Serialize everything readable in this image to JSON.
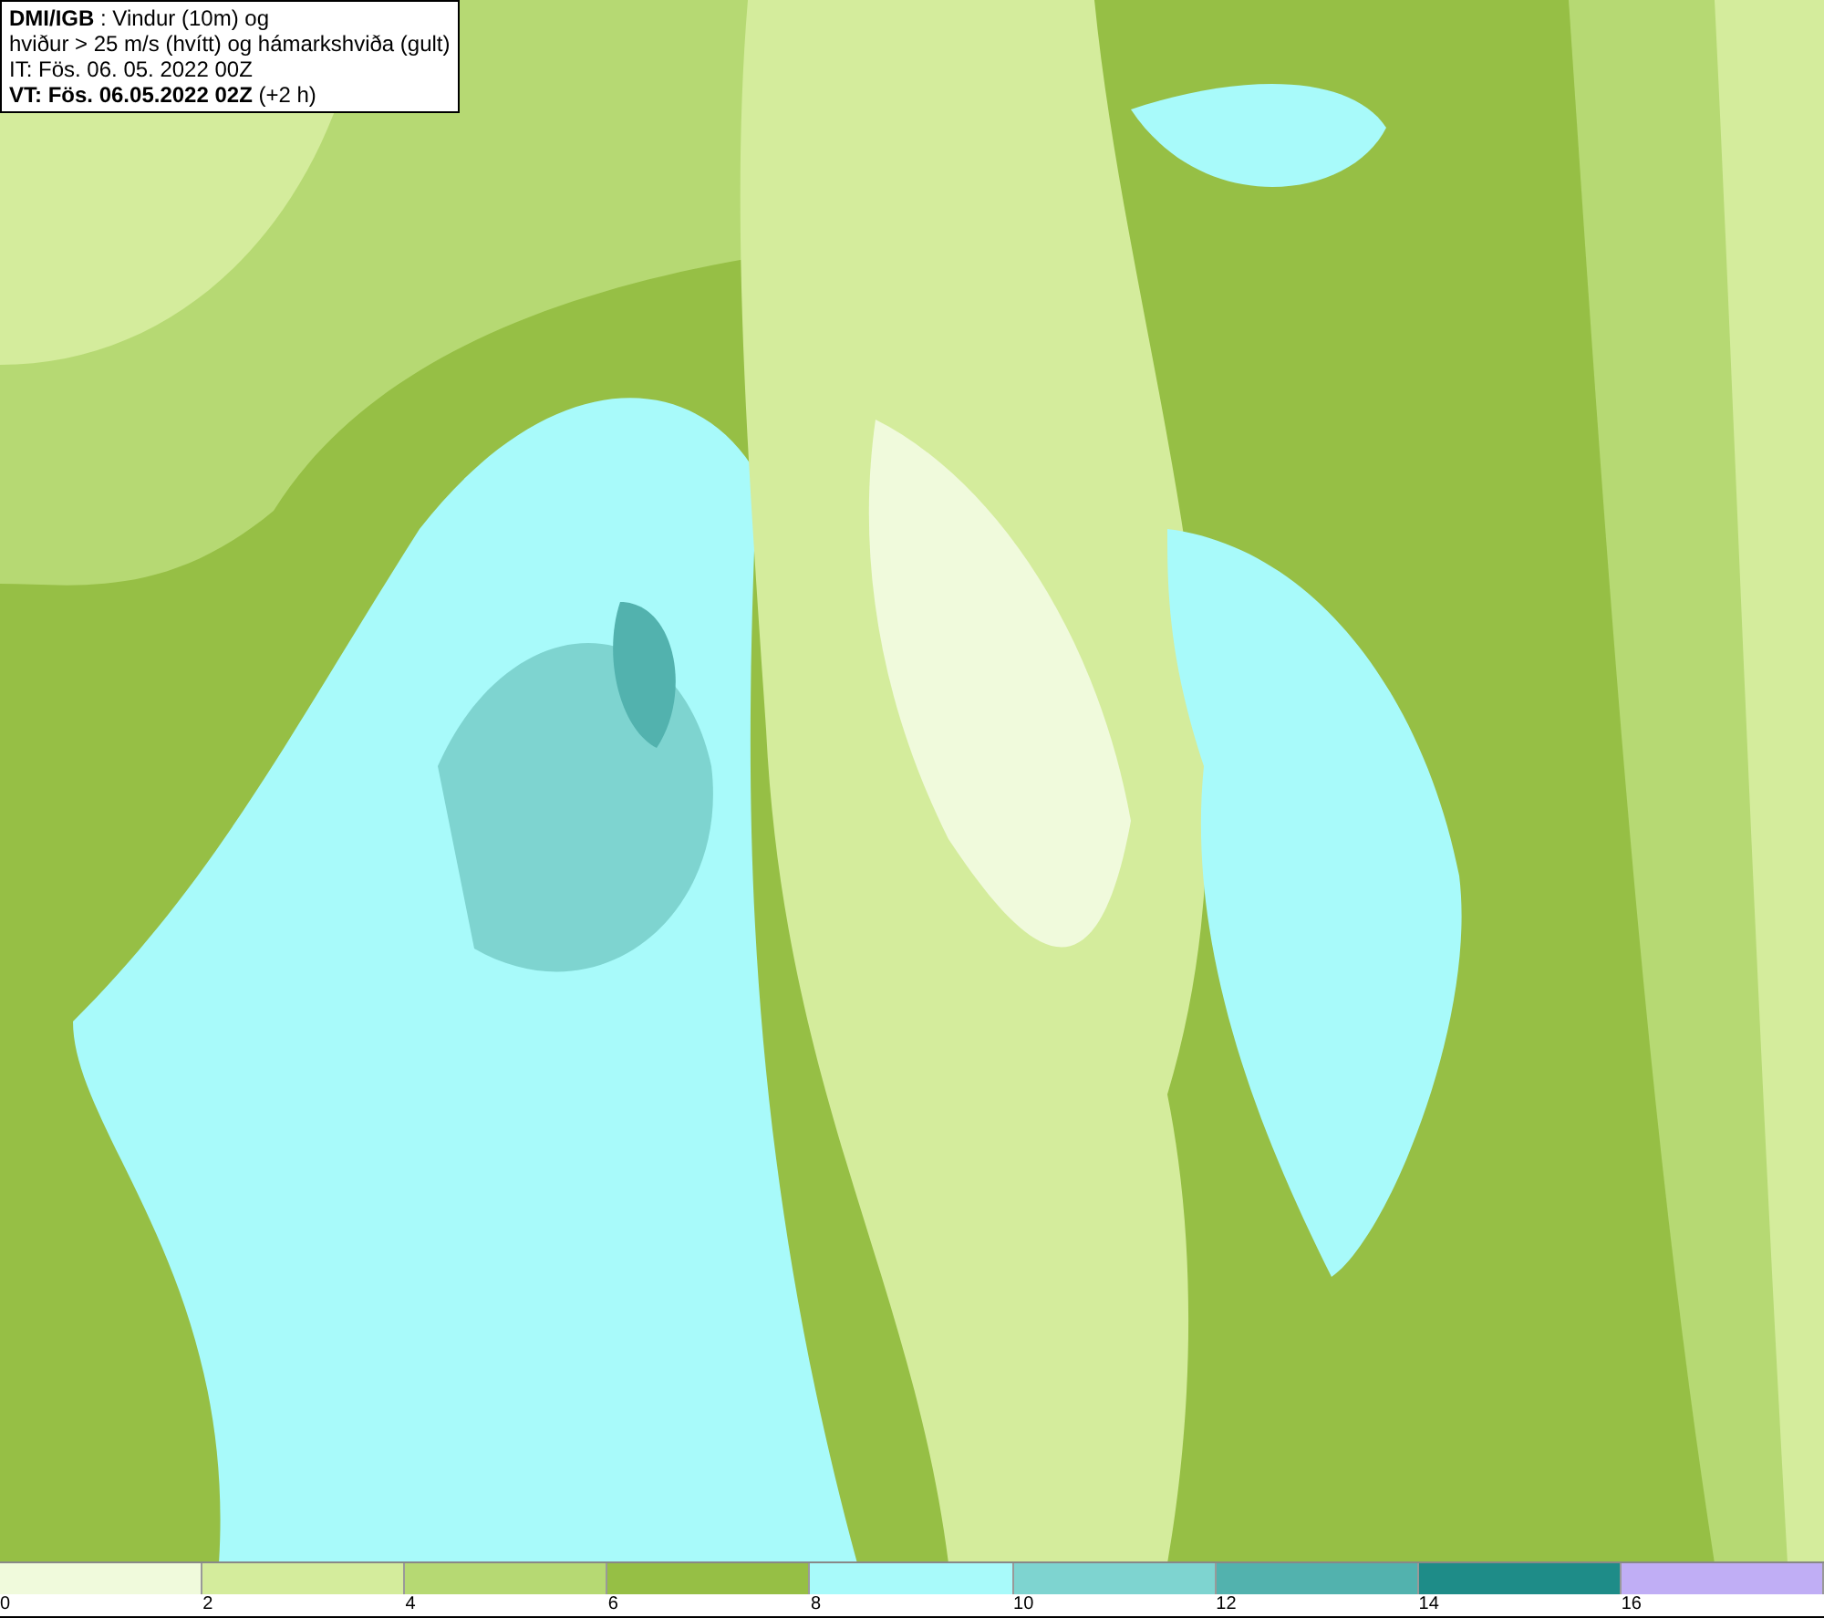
{
  "title_box": {
    "lines": [
      "**DMI/IGB** : Vindur (10m) og",
      "hviður > 25 m/s (hvítt) og hámarkshviða (gult)",
      "IT: Fös. 06. 05. 2022 00Z",
      "**VT: Fös. 06.05.2022 02Z** (+2 h)"
    ]
  },
  "legend": [
    {
      "label": "0",
      "color": "#f0fadc"
    },
    {
      "label": "2",
      "color": "#d4ec9c"
    },
    {
      "label": "4",
      "color": "#b6d973"
    },
    {
      "label": "6",
      "color": "#96bf45"
    },
    {
      "label": "8",
      "color": "#a8fafa"
    },
    {
      "label": "10",
      "color": "#7ed4d0"
    },
    {
      "label": "12",
      "color": "#52b2ae"
    },
    {
      "label": "14",
      "color": "#1e8c88"
    },
    {
      "label": "16",
      "color": "#c0aef5"
    }
  ]
}
